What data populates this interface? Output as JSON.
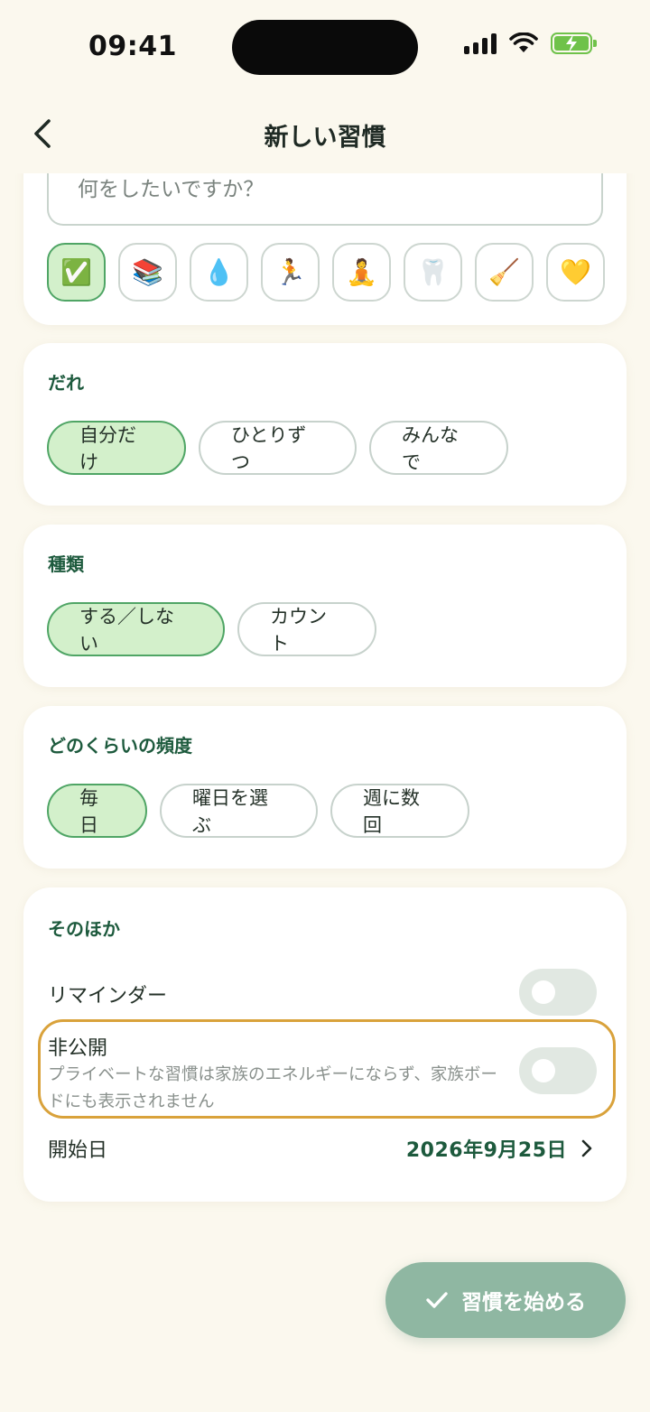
{
  "status": {
    "time": "09:41"
  },
  "nav": {
    "title": "新しい習慣"
  },
  "name_field": {
    "placeholder": "何をしたいですか？"
  },
  "icons": [
    "✅",
    "📚",
    "💧",
    "🏃",
    "🧘",
    "🦷",
    "🧹",
    "💛"
  ],
  "who": {
    "label": "だれ",
    "options": [
      "自分だけ",
      "ひとりずつ",
      "みんなで"
    ],
    "selected": 0
  },
  "kind": {
    "label": "種類",
    "options": [
      "する／しない",
      "カウント"
    ],
    "selected": 0
  },
  "frequency": {
    "label": "どのくらいの頻度",
    "options": [
      "毎日",
      "曜日を選ぶ",
      "週に数回"
    ],
    "selected": 0
  },
  "other": {
    "label": "そのほか",
    "reminder": {
      "label": "リマインダー",
      "on": false
    },
    "private": {
      "label": "非公開",
      "description": "プライベートな習慣は家族のエネルギーにならず、家族ボードにも表示されません",
      "on": false
    },
    "start_date": {
      "label": "開始日",
      "value": "2026年9月25日"
    }
  },
  "cta": {
    "label": "習慣を始める"
  },
  "colors": {
    "accent": "#1d5a3d",
    "selected_bg": "#d3f0cb",
    "highlight": "#d9a23b",
    "cta": "#8fb7a2"
  }
}
